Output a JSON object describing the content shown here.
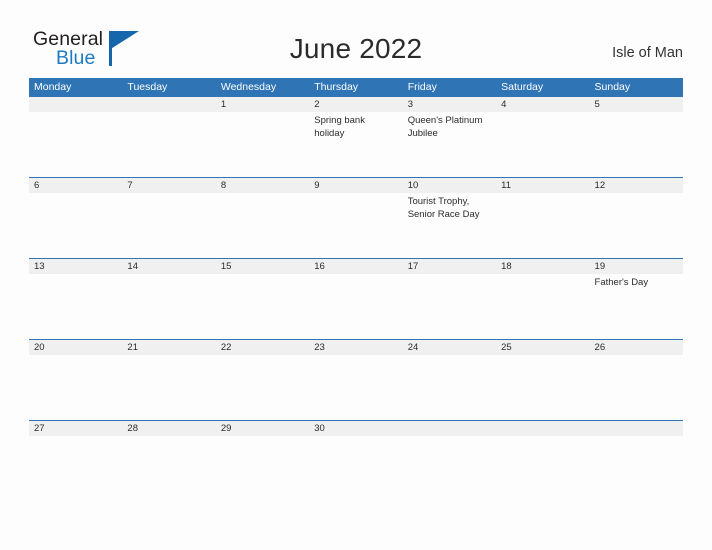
{
  "brand": {
    "name_part1": "General",
    "name_part2": "Blue",
    "triangle_icon": "triangle-logo-icon",
    "accent_color": "#1566ab"
  },
  "header": {
    "title": "June 2022",
    "region": "Isle of Man"
  },
  "colors": {
    "header_blue": "#2f74b5",
    "day_band_gray": "#f0f0f0",
    "page_background": "#fdfdfd",
    "text": "#2b2b2b"
  },
  "weekdays": [
    "Monday",
    "Tuesday",
    "Wednesday",
    "Thursday",
    "Friday",
    "Saturday",
    "Sunday"
  ],
  "weeks": [
    {
      "days": [
        {
          "num": "",
          "events": []
        },
        {
          "num": "",
          "events": []
        },
        {
          "num": "1",
          "events": []
        },
        {
          "num": "2",
          "events": [
            "Spring bank holiday"
          ]
        },
        {
          "num": "3",
          "events": [
            "Queen's Platinum Jubilee"
          ]
        },
        {
          "num": "4",
          "events": []
        },
        {
          "num": "5",
          "events": []
        }
      ]
    },
    {
      "days": [
        {
          "num": "6",
          "events": []
        },
        {
          "num": "7",
          "events": []
        },
        {
          "num": "8",
          "events": []
        },
        {
          "num": "9",
          "events": []
        },
        {
          "num": "10",
          "events": [
            "Tourist Trophy, Senior Race Day"
          ]
        },
        {
          "num": "11",
          "events": []
        },
        {
          "num": "12",
          "events": []
        }
      ]
    },
    {
      "days": [
        {
          "num": "13",
          "events": []
        },
        {
          "num": "14",
          "events": []
        },
        {
          "num": "15",
          "events": []
        },
        {
          "num": "16",
          "events": []
        },
        {
          "num": "17",
          "events": []
        },
        {
          "num": "18",
          "events": []
        },
        {
          "num": "19",
          "events": [
            "Father's Day"
          ]
        }
      ]
    },
    {
      "days": [
        {
          "num": "20",
          "events": []
        },
        {
          "num": "21",
          "events": []
        },
        {
          "num": "22",
          "events": []
        },
        {
          "num": "23",
          "events": []
        },
        {
          "num": "24",
          "events": []
        },
        {
          "num": "25",
          "events": []
        },
        {
          "num": "26",
          "events": []
        }
      ]
    },
    {
      "days": [
        {
          "num": "27",
          "events": []
        },
        {
          "num": "28",
          "events": []
        },
        {
          "num": "29",
          "events": []
        },
        {
          "num": "30",
          "events": []
        },
        {
          "num": "",
          "events": []
        },
        {
          "num": "",
          "events": []
        },
        {
          "num": "",
          "events": []
        }
      ]
    }
  ]
}
